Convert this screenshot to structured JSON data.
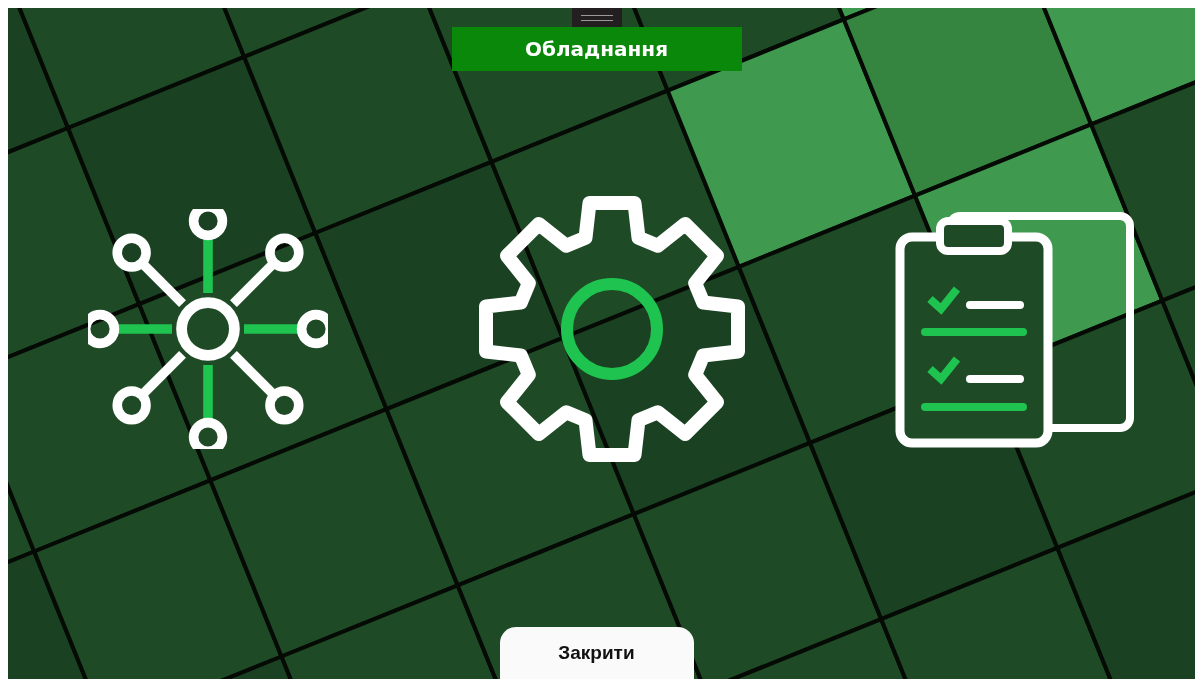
{
  "title": "Обладнання",
  "tiles": [
    {
      "kind": "network"
    },
    {
      "kind": "settings"
    },
    {
      "kind": "checklist"
    }
  ],
  "close_button": "Закрити"
}
